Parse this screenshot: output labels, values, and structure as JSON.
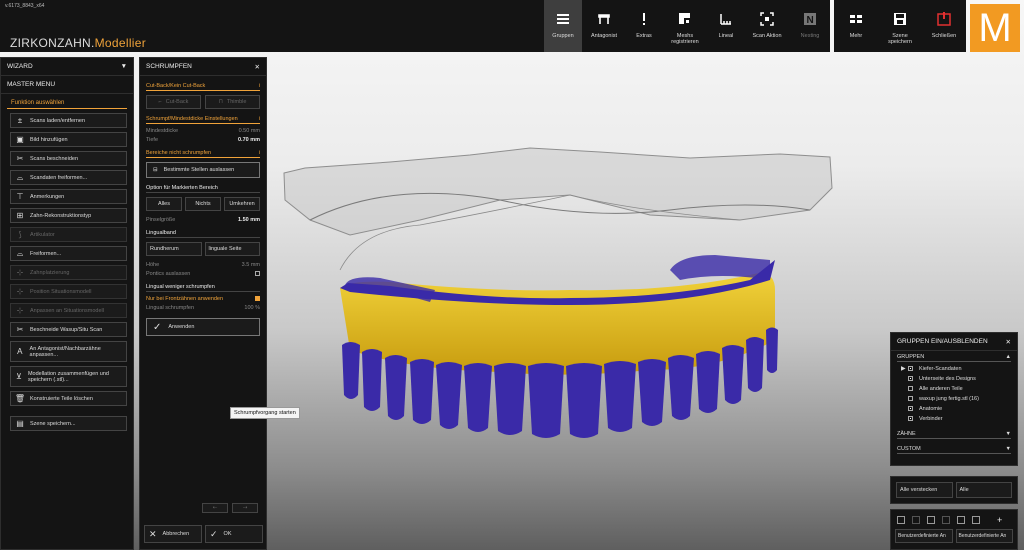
{
  "app": {
    "version": "v.6173_8843_x64",
    "brand_main": "ZIRKONZAHN.",
    "brand_accent": "Modellier",
    "logo_letter": "M"
  },
  "colors": {
    "accent": "#f0a33a",
    "logo": "#f29a22",
    "teeth_blue": "#3a2aa8",
    "gum_yellow": "#e6c21a"
  },
  "toolbar": {
    "items": [
      {
        "label": "Gruppen",
        "icon": "menu-icon",
        "active": true
      },
      {
        "label": "Antagonist",
        "icon": "antagonist-icon"
      },
      {
        "label": "Extras",
        "icon": "exclamation-icon"
      },
      {
        "label": "Meshs registrieren",
        "icon": "mesh-register-icon"
      },
      {
        "label": "Lineal",
        "icon": "ruler-icon"
      },
      {
        "label": "Scan Aktion",
        "icon": "scan-action-icon"
      },
      {
        "label": "Nesting",
        "icon": "nesting-icon",
        "disabled": true
      }
    ],
    "right": [
      {
        "label": "Mehr",
        "icon": "more-icon"
      },
      {
        "label": "Szene speichern",
        "icon": "save-icon"
      },
      {
        "label": "Schließen",
        "icon": "power-icon"
      }
    ]
  },
  "wizard": {
    "title": "WIZARD",
    "master_menu": "MASTER MENU",
    "section": "Funktion auswählen",
    "buttons": [
      {
        "label": "Scans laden/entfernen",
        "icon": "scan-load-icon"
      },
      {
        "label": "Bild hinzufügen",
        "icon": "image-add-icon"
      },
      {
        "label": "Scans beschneiden",
        "icon": "scissors-icon"
      },
      {
        "label": "Scandaten freiformen...",
        "icon": "freeform-icon"
      },
      {
        "label": "Anmerkungen",
        "icon": "annotation-icon"
      },
      {
        "label": "Zahn-Rekonstruktionstyp",
        "icon": "tooth-type-icon"
      },
      {
        "label": "Artikulator",
        "icon": "articulator-icon",
        "disabled": true
      },
      {
        "label": "Freiformen...",
        "icon": "freeform-icon"
      },
      {
        "label": "Zahnplatzierung",
        "icon": "tooth-place-icon",
        "disabled": true
      },
      {
        "label": "Position Situationsmodell",
        "icon": "position-icon",
        "disabled": true
      },
      {
        "label": "Anpassen an Situationsmodell",
        "icon": "adjust-icon",
        "disabled": true
      },
      {
        "label": "Beschneide Wasup/Situ Scan",
        "icon": "scissors-icon"
      },
      {
        "label": "An Antagonist/Nachbarzähne anpassen...",
        "icon": "letter-a-icon",
        "tall": true
      },
      {
        "label": "Modellation zusammenfügen und speichern (.stl)...",
        "icon": "merge-icon",
        "tall": true
      },
      {
        "label": "Konstruierte Teile löschen",
        "icon": "trash-icon"
      },
      {
        "label": "Szene speichern...",
        "icon": "save-icon",
        "gap": true
      }
    ]
  },
  "shrink": {
    "title": "SCHRUMPFEN",
    "cutback_header": "Cut-Back/Kein Cut-Back",
    "cutback_btn": "Cut-Back",
    "thimble_btn": "Thimble",
    "settings_header": "Schrumpf/Mindestdicke Einstellungen",
    "min_label": "Mindestdicke",
    "min_value": "0.50  mm",
    "depth_label": "Tiefe",
    "depth_value": "0.70  mm",
    "noshrink_header": "Bereiche nicht schrumpfen",
    "exclude_btn": "Bestimmte Stellen auslassen",
    "option_header": "Option für Markierten Bereich",
    "opt_all": "Alles",
    "opt_none": "Nichts",
    "opt_invert": "Umkehren",
    "brush_label": "Pinselgröße",
    "brush_value": "1.50  mm",
    "lingual_header": "Lingualband",
    "around_btn": "Rundherum",
    "lingual_btn": "linguale Seite",
    "height_label": "Höhe",
    "height_value": "3.5  mm",
    "pontics_label": "Pontics auslassen",
    "lessshrink_header": "Lingual weniger schrumpfen",
    "front_label": "Nur bei Frontzähnen anwenden",
    "lingshrink_label": "Lingual schrumpfen",
    "lingshrink_value": "100  %",
    "apply_btn": "Anwenden",
    "tooltip": "Schrumpfvorgang starten",
    "cancel_btn": "Abbrechen",
    "ok_btn": "OK"
  },
  "groups": {
    "title": "GRUPPEN EIN/AUSBLENDEN",
    "section": "GRUPPEN",
    "items": [
      {
        "label": "Kiefer-Scandaten",
        "expand": true,
        "checked": true
      },
      {
        "label": "Unterseite des Designs",
        "checked": true
      },
      {
        "label": "Alle anderen Teile",
        "checked": false
      },
      {
        "label": "waxup jung fertig.stl (16)",
        "checked": false
      },
      {
        "label": "Anatomie",
        "checked": true
      },
      {
        "label": "Verbinder",
        "checked": true
      }
    ],
    "teeth": "ZÄHNE",
    "custom": "CUSTOM",
    "hide_all": "Alle verstecken",
    "all": "Alle",
    "custom_btn1": "Benutzerdefinierte An",
    "custom_btn2": "Benutzerdefinierte An"
  }
}
